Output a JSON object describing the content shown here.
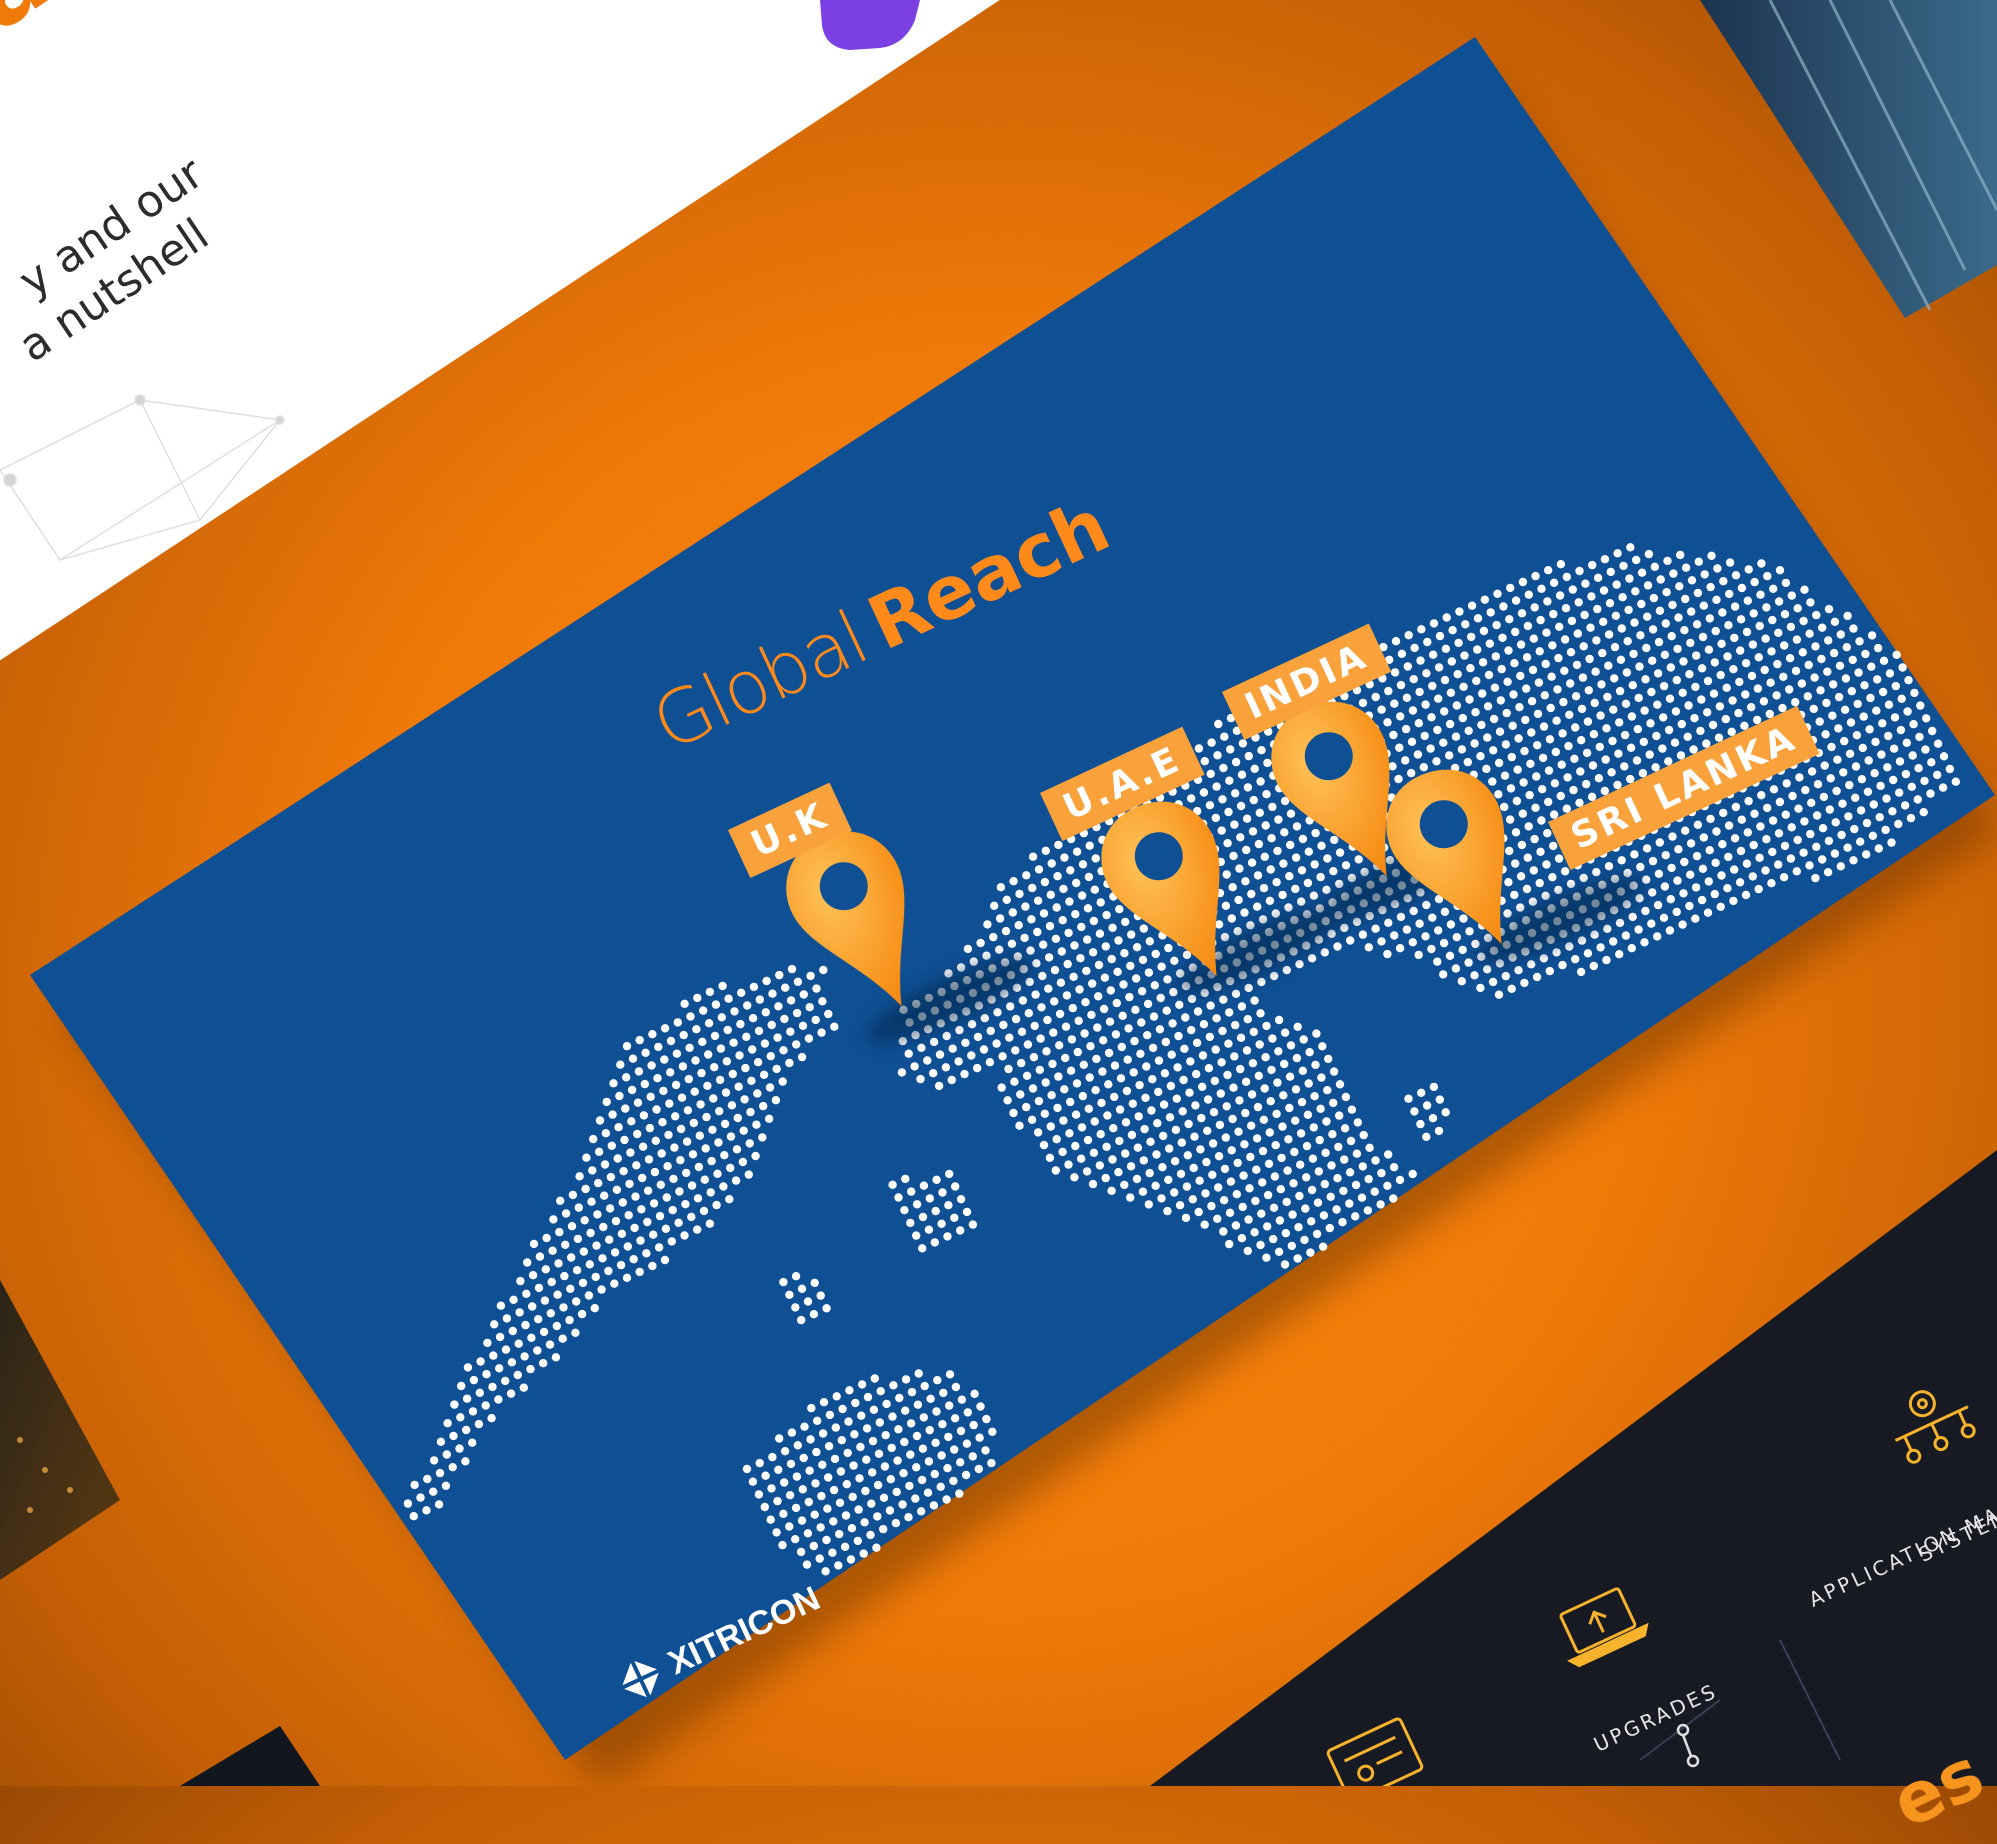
{
  "left_slide": {
    "title_partial": "ation",
    "subtitle_line1": "y and our",
    "subtitle_line2": "a nutshell"
  },
  "main_slide": {
    "title_light": "Global",
    "title_bold": "Reach",
    "locations": [
      {
        "label": "U.K"
      },
      {
        "label": "U.A.E"
      },
      {
        "label": "INDIA"
      },
      {
        "label": "SRI LANKA"
      }
    ],
    "brand": "XITRICON",
    "colors": {
      "background": "#0f4f94",
      "accent": "#ff8a1a",
      "label": "#f9a23c",
      "dots": "#ffffff"
    }
  },
  "bottom_slide": {
    "services": [
      {
        "label": "UPGRADES",
        "icon": "laptop-upload-icon"
      },
      {
        "label": "APPLICATION MA",
        "icon": "gear-network-icon"
      },
      {
        "label": "SYSTEM",
        "icon": "gear-network-icon"
      }
    ],
    "title_partial": "es"
  },
  "colors": {
    "backdrop": "#f07a08"
  }
}
